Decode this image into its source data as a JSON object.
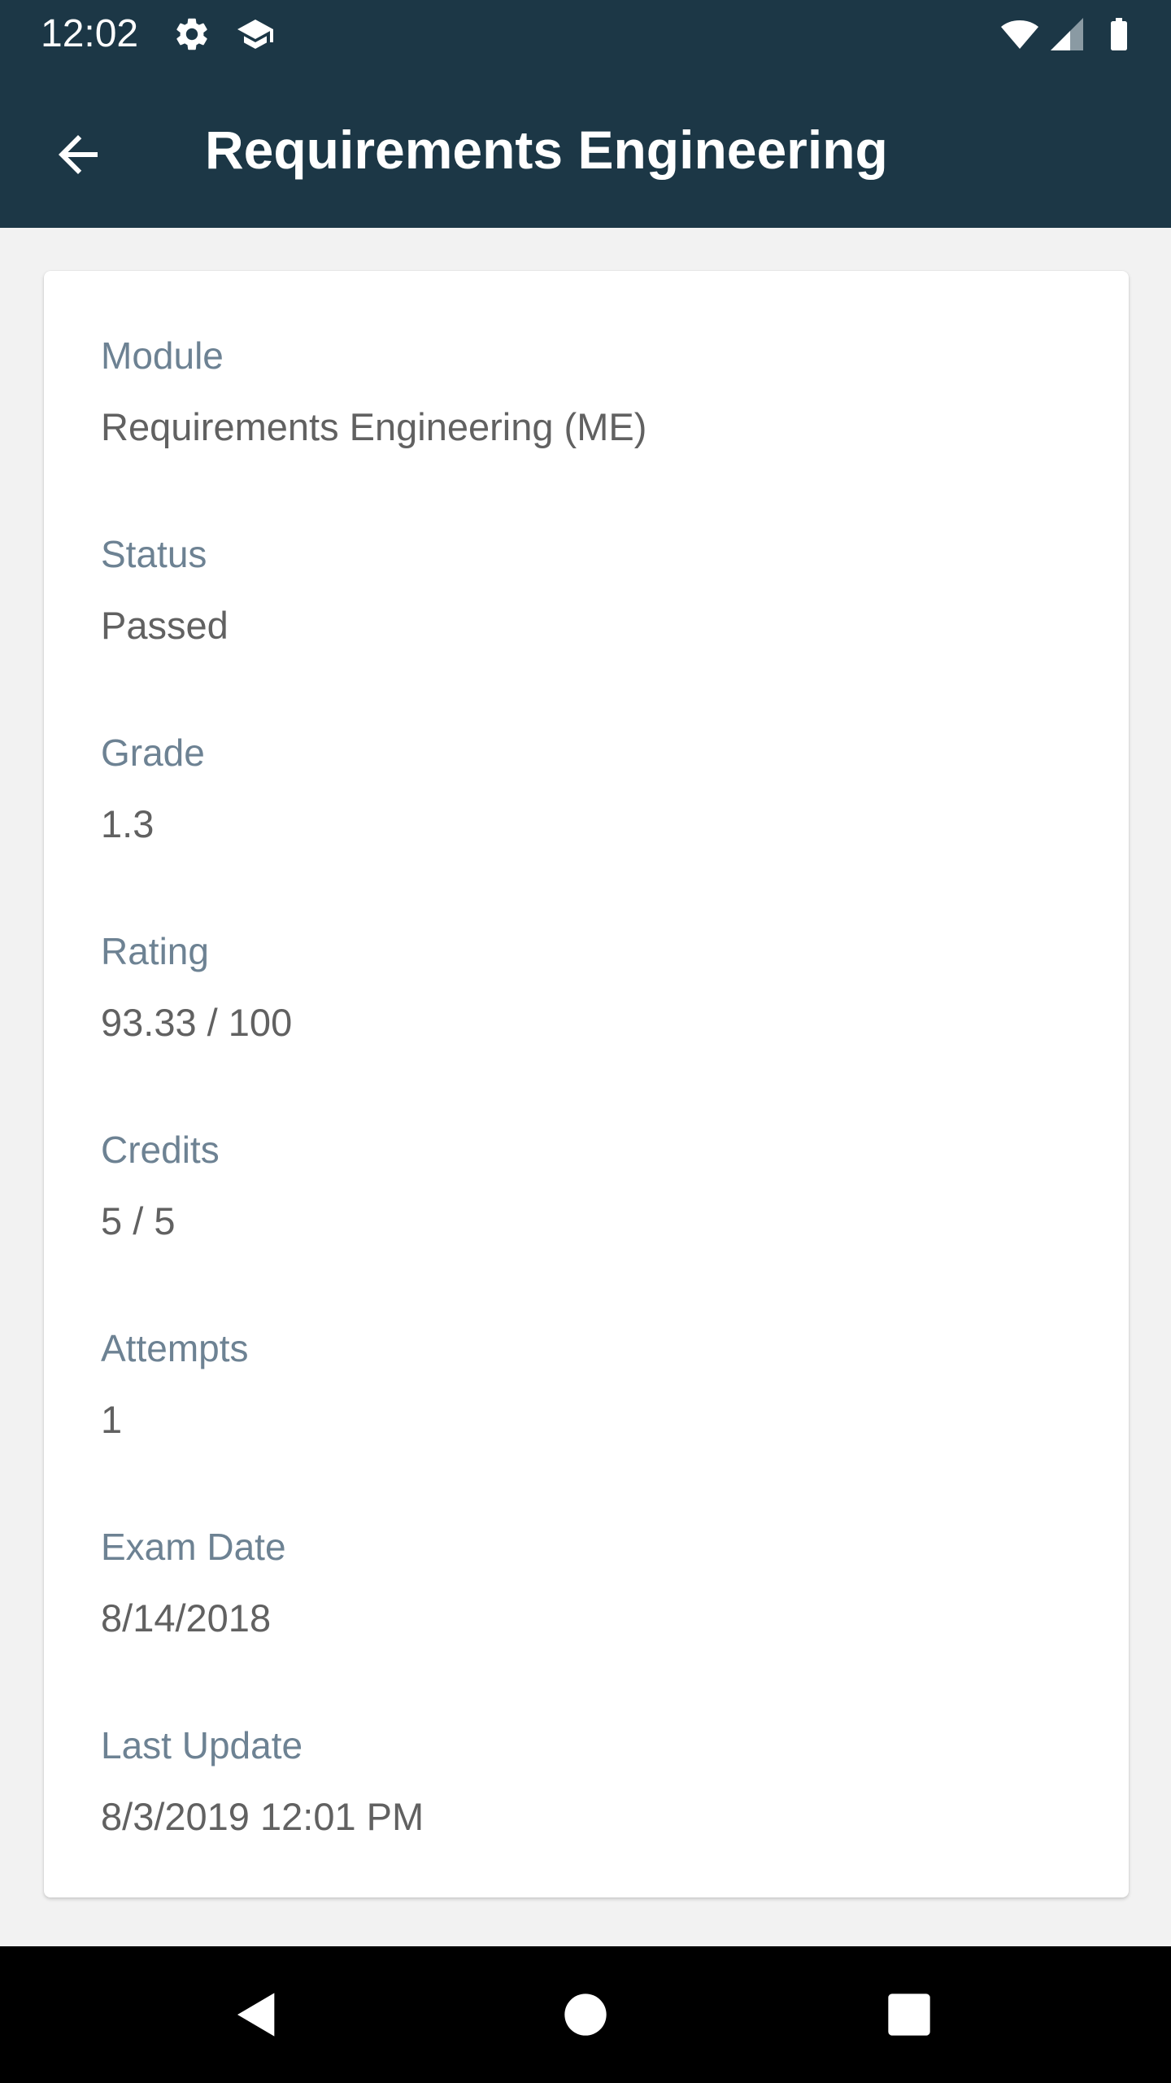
{
  "status_bar": {
    "time": "12:02",
    "icons": [
      "settings-icon",
      "school-icon",
      "wifi-icon",
      "signal-icon",
      "battery-icon"
    ]
  },
  "app_bar": {
    "back_icon": "arrow-back-icon",
    "title": "Requirements Engineering",
    "background_color": "#1c3746"
  },
  "details": {
    "fields": [
      {
        "label": "Module",
        "value": "Requirements Engineering (ME)"
      },
      {
        "label": "Status",
        "value": "Passed"
      },
      {
        "label": "Grade",
        "value": "1.3"
      },
      {
        "label": "Rating",
        "value": "93.33 / 100"
      },
      {
        "label": "Credits",
        "value": "5 / 5"
      },
      {
        "label": "Attempts",
        "value": "1"
      },
      {
        "label": "Exam Date",
        "value": "8/14/2018"
      },
      {
        "label": "Last Update",
        "value": "8/3/2019 12:01 PM"
      }
    ]
  },
  "nav_bar": {
    "buttons": [
      "back-triangle-icon",
      "home-circle-icon",
      "recents-square-icon"
    ]
  },
  "colors": {
    "accent": "#1c3746",
    "label": "#6d8293",
    "value": "#616161",
    "background": "#f2f2f2"
  }
}
